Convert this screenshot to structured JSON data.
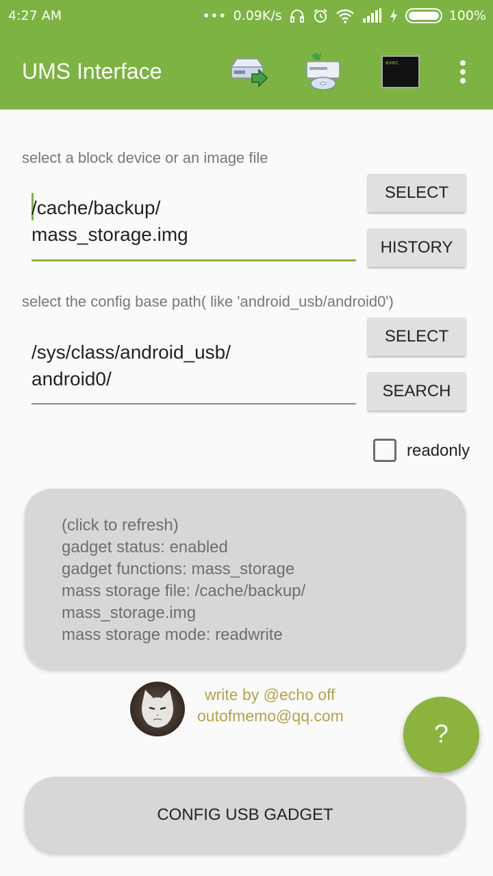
{
  "status_bar": {
    "time": "4:27 AM",
    "net_speed": "0.09K/s",
    "battery": "100%",
    "icons": [
      "dots-icon",
      "headphones-icon",
      "alarm-icon",
      "wifi-icon",
      "signal-icon",
      "charging-icon",
      "battery-icon"
    ]
  },
  "app_bar": {
    "title": "UMS Interface",
    "actions": [
      "drive-export-icon",
      "cd-import-icon",
      "exec-terminal-icon",
      "more-vert-icon"
    ],
    "exec_text": "exec",
    "accent_color": "#7cb342"
  },
  "image_section": {
    "label": "select a block device or an image file",
    "path_line1": "/cache/backup/",
    "path_line2": "mass_storage.img",
    "select_button": "SELECT",
    "history_button": "HISTORY"
  },
  "config_section": {
    "label": "select the config base path( like 'android_usb/android0')",
    "path_line1": "/sys/class/android_usb/",
    "path_line2": "android0/",
    "select_button": "SELECT",
    "search_button": "SEARCH"
  },
  "readonly": {
    "label": "readonly",
    "checked": false
  },
  "status_card": {
    "lines": [
      "(click to refresh)",
      "gadget status: enabled",
      "gadget functions: mass_storage",
      "mass storage file: /cache/backup/",
      "mass_storage.img",
      "mass storage mode: readwrite"
    ]
  },
  "credit": {
    "line1": "write by @echo off",
    "line2": "outofmemo@qq.com",
    "text_color": "#b5a24a"
  },
  "fab": {
    "label": "?",
    "color": "#8bb33d"
  },
  "config_button": {
    "label": "CONFIG USB GADGET"
  }
}
